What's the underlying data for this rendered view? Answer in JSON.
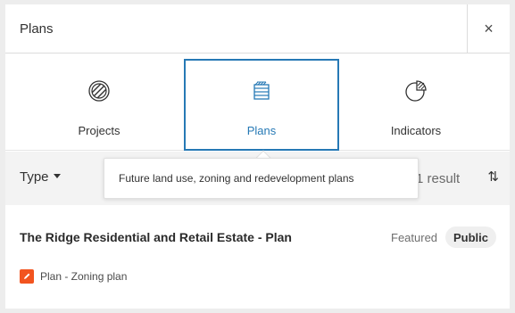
{
  "header": {
    "title": "Plans",
    "close_glyph": "×"
  },
  "tabs": [
    {
      "label": "Projects",
      "icon": "projects-icon",
      "active": false
    },
    {
      "label": "Plans",
      "icon": "plans-icon",
      "active": true
    },
    {
      "label": "Indicators",
      "icon": "indicators-icon",
      "active": false
    }
  ],
  "toolbar": {
    "type_label": "Type",
    "result_text": "1 result",
    "sort_glyph": "⇅"
  },
  "tooltip": {
    "text": "Future land use, zoning and redevelopment plans"
  },
  "card": {
    "title": "The Ridge Residential and Retail Estate - Plan",
    "featured": "Featured",
    "visibility": "Public",
    "type": "Plan - Zoning plan"
  },
  "colors": {
    "accent": "#2679b5",
    "plan_badge": "#f2541f",
    "toolbar_bg": "#f3f3f3"
  }
}
